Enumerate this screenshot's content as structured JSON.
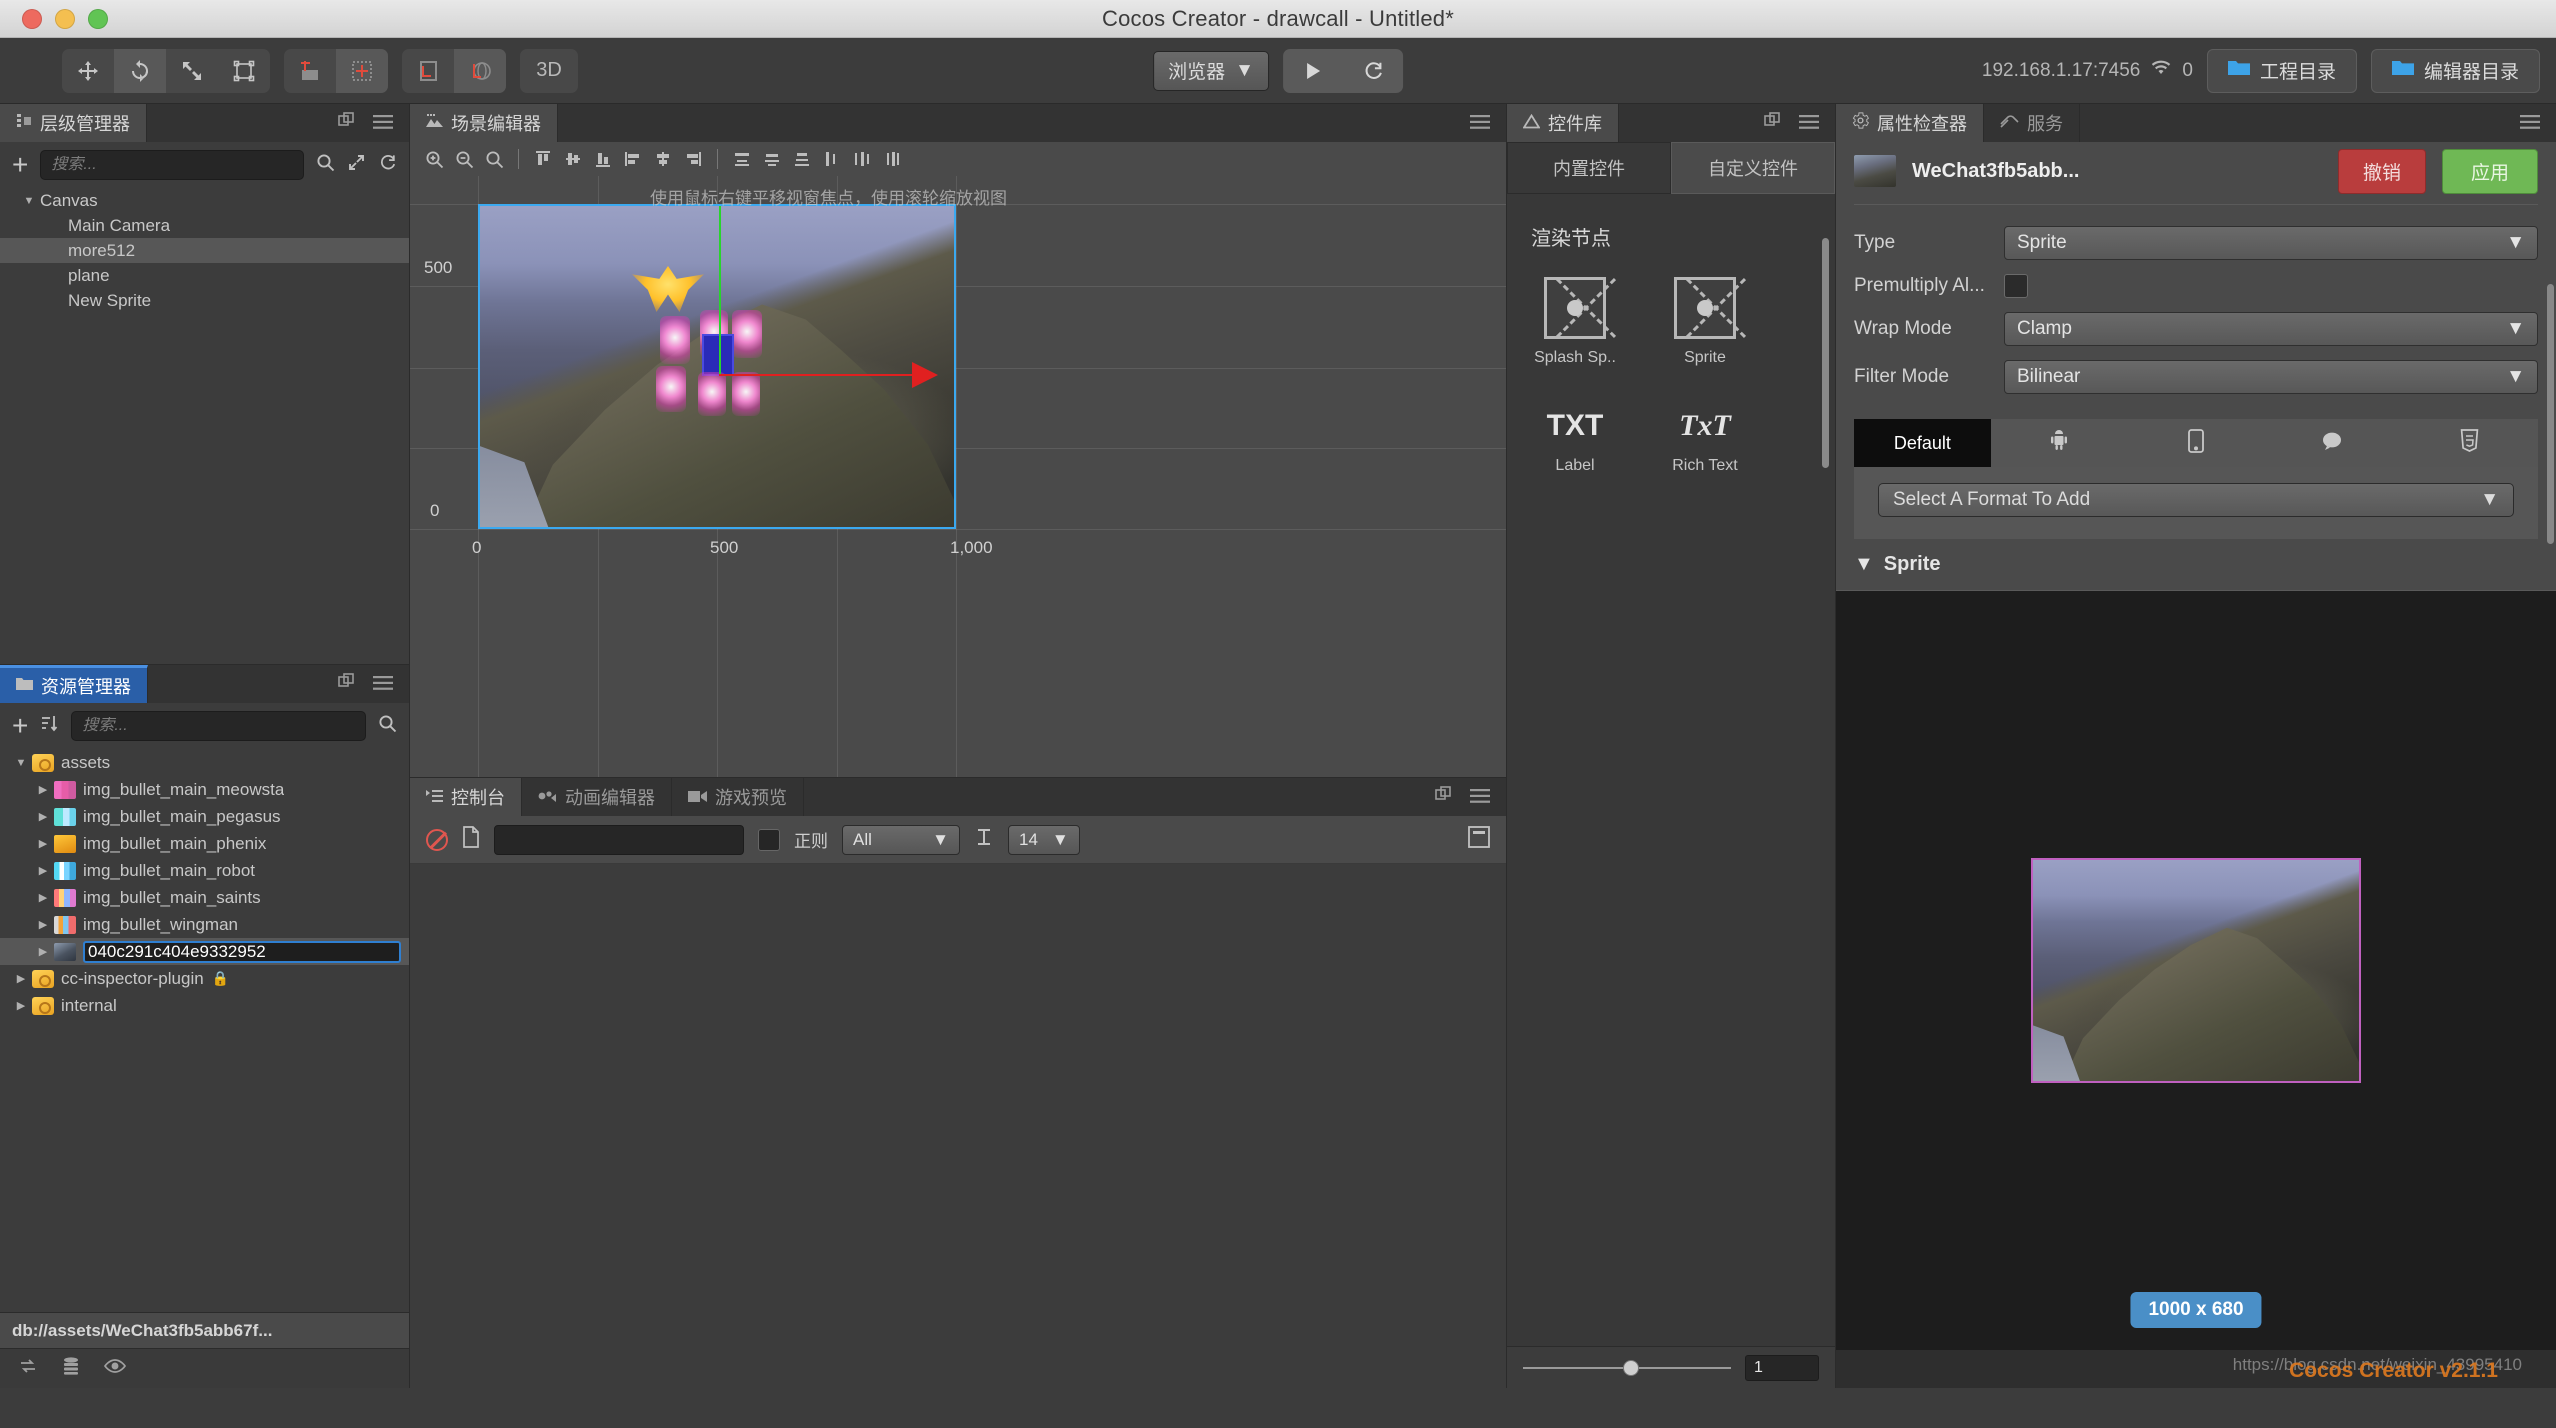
{
  "window": {
    "title": "Cocos Creator - drawcall - Untitled*",
    "traffic": {
      "close": "close-button",
      "minimize": "minimize-button",
      "maximize": "maximize-button"
    }
  },
  "toolbar": {
    "transform_tools": [
      {
        "name": "move-tool",
        "icon": "move-icon",
        "active": false
      },
      {
        "name": "rotate-tool",
        "icon": "rotate-icon",
        "active": true
      },
      {
        "name": "scale-tool",
        "icon": "scale-icon",
        "active": false
      },
      {
        "name": "rect-tool",
        "icon": "rect-transform-icon",
        "active": false
      }
    ],
    "pivot_tools": [
      {
        "name": "pivot-tool",
        "icon": "pivot-icon",
        "active": false
      },
      {
        "name": "center-tool",
        "icon": "center-icon",
        "active": true
      }
    ],
    "coord_tools": [
      {
        "name": "local-coord-tool",
        "icon": "local-axis-icon",
        "active": false
      },
      {
        "name": "global-coord-tool",
        "icon": "global-axis-icon",
        "active": true
      }
    ],
    "mode_3d_label": "3D",
    "preview_target": "浏览器",
    "play_label": "play-icon",
    "refresh_label": "refresh-icon",
    "ip_address": "192.168.1.17:7456",
    "wifi_icon": "wifi-icon",
    "device_count": "0",
    "project_dir_label": "工程目录",
    "editor_dir_label": "编辑器目录"
  },
  "hierarchy": {
    "tab_label": "层级管理器",
    "tab_icon": "hierarchy-icon",
    "search_placeholder": "搜索...",
    "add_label": "+",
    "tools": [
      "search-icon",
      "expand-icon",
      "refresh-icon"
    ],
    "panel_tools": [
      "popout-icon",
      "menu-icon"
    ],
    "nodes": [
      {
        "label": "Canvas",
        "depth": 0,
        "expanded": true,
        "selected": false
      },
      {
        "label": "Main Camera",
        "depth": 1,
        "expanded": false,
        "selected": false
      },
      {
        "label": "more512",
        "depth": 1,
        "expanded": false,
        "selected": true
      },
      {
        "label": "plane",
        "depth": 1,
        "expanded": false,
        "selected": false
      },
      {
        "label": "New Sprite",
        "depth": 1,
        "expanded": false,
        "selected": false
      }
    ]
  },
  "assets": {
    "tab_label": "资源管理器",
    "tab_icon": "folder-icon",
    "search_placeholder": "搜索...",
    "add_label": "+",
    "sort_icon": "sort-icon",
    "search_icon": "search-icon",
    "panel_tools": [
      "popout-icon",
      "menu-icon"
    ],
    "items": [
      {
        "label": "assets",
        "depth": 0,
        "expanded": true,
        "icon": "ico-folder",
        "selected": false,
        "locked": false,
        "editing": false
      },
      {
        "label": "img_bullet_main_meowsta",
        "depth": 1,
        "expanded": false,
        "icon": "ico-meow",
        "selected": false,
        "locked": false,
        "editing": false
      },
      {
        "label": "img_bullet_main_pegasus",
        "depth": 1,
        "expanded": false,
        "icon": "ico-peg",
        "selected": false,
        "locked": false,
        "editing": false
      },
      {
        "label": "img_bullet_main_phenix",
        "depth": 1,
        "expanded": false,
        "icon": "ico-phe",
        "selected": false,
        "locked": false,
        "editing": false
      },
      {
        "label": "img_bullet_main_robot",
        "depth": 1,
        "expanded": false,
        "icon": "ico-rob",
        "selected": false,
        "locked": false,
        "editing": false
      },
      {
        "label": "img_bullet_main_saints",
        "depth": 1,
        "expanded": false,
        "icon": "ico-sai",
        "selected": false,
        "locked": false,
        "editing": false
      },
      {
        "label": "img_bullet_wingman",
        "depth": 1,
        "expanded": false,
        "icon": "ico-wing",
        "selected": false,
        "locked": false,
        "editing": false
      },
      {
        "label": "040c291c404e9332952",
        "depth": 1,
        "expanded": false,
        "icon": "ico-img",
        "selected": true,
        "locked": false,
        "editing": true
      },
      {
        "label": "cc-inspector-plugin",
        "depth": 0,
        "expanded": false,
        "icon": "ico-folder",
        "selected": false,
        "locked": true,
        "editing": false
      },
      {
        "label": "internal",
        "depth": 0,
        "expanded": false,
        "icon": "ico-folder",
        "selected": false,
        "locked": false,
        "editing": false
      }
    ],
    "path_bar": "db://assets/WeChat3fb5abb67f...",
    "status_icons": [
      "sync-icon",
      "database-icon",
      "eye-icon"
    ]
  },
  "scene": {
    "tab_label": "场景编辑器",
    "tab_icon": "scene-icon",
    "panel_tools": [
      "menu-icon"
    ],
    "tools": [
      "zoom-in-icon",
      "zoom-out-icon",
      "zoom-reset-icon",
      "align-left-icon",
      "align-center-h-icon",
      "align-right-icon",
      "align-top-icon",
      "align-middle-icon",
      "align-bottom-icon",
      "distribute-h-start-icon",
      "distribute-h-center-icon",
      "distribute-h-end-icon",
      "distribute-v-start-icon",
      "distribute-v-center-icon",
      "distribute-v-end-icon"
    ],
    "hint": "使用鼠标右键平移视窗焦点，使用滚轮缩放视图",
    "ruler": {
      "y_500": "500",
      "y_0": "0",
      "x_0": "0",
      "x_500": "500",
      "x_1000": "1,000"
    }
  },
  "widget_library": {
    "tab_label": "控件库",
    "tab_icon": "widget-library-icon",
    "panel_tools": [
      "popout-icon",
      "menu-icon"
    ],
    "tabs": [
      {
        "label": "内置控件",
        "selected": false
      },
      {
        "label": "自定义控件",
        "selected": true
      }
    ],
    "section_title": "渲染节点",
    "items": [
      {
        "label": "Splash Sp..",
        "glyph": "node",
        "icon": "splash-sprite-icon"
      },
      {
        "label": "Sprite",
        "glyph": "node",
        "icon": "sprite-icon"
      },
      {
        "label": "Label",
        "glyph": "TXT",
        "icon": "label-icon"
      },
      {
        "label": "Rich Text",
        "glyph": "TxT",
        "icon": "rich-text-icon"
      }
    ],
    "zoom_value": "1"
  },
  "inspector": {
    "tabs": [
      {
        "label": "属性检查器",
        "icon": "gear-icon",
        "selected": true
      },
      {
        "label": "服务",
        "icon": "services-icon",
        "selected": false
      }
    ],
    "panel_tools": [
      "menu-icon"
    ],
    "asset_name": "WeChat3fb5abb...",
    "revert_label": "撤销",
    "apply_label": "应用",
    "properties": [
      {
        "label": "Type",
        "type": "select",
        "value": "Sprite"
      },
      {
        "label": "Premultiply Al...",
        "type": "checkbox",
        "value": false
      },
      {
        "label": "Wrap Mode",
        "type": "select",
        "value": "Clamp"
      },
      {
        "label": "Filter Mode",
        "type": "select",
        "value": "Bilinear"
      }
    ],
    "platform_tabs": [
      {
        "label": "Default",
        "icon": "default-icon",
        "selected": true
      },
      {
        "label": "",
        "icon": "android-icon",
        "selected": false
      },
      {
        "label": "",
        "icon": "ios-icon",
        "selected": false
      },
      {
        "label": "",
        "icon": "wechat-icon",
        "selected": false
      },
      {
        "label": "",
        "icon": "html5-icon",
        "selected": false
      }
    ],
    "format_placeholder": "Select A Format To Add",
    "sprite_section": "Sprite",
    "preview_size": "1000 x 680",
    "watermark_url": "https://blog.csdn.net/weixin_43995410",
    "watermark_version": "Cocos Creator v2.1.1"
  },
  "console": {
    "tabs": [
      {
        "label": "控制台",
        "icon": "console-icon",
        "selected": true
      },
      {
        "label": "动画编辑器",
        "icon": "animation-icon",
        "selected": false
      },
      {
        "label": "游戏预览",
        "icon": "game-preview-icon",
        "selected": false
      }
    ],
    "panel_tools": [
      "popout-icon",
      "menu-icon"
    ],
    "clear_icon": "clear-icon",
    "file_icon": "file-icon",
    "filter_value": "",
    "regex_checked": false,
    "regex_label": "正则",
    "level_filter": "All",
    "font_size_icon": "font-size-icon",
    "font_size": "14",
    "collapse_icon": "collapse-icon"
  }
}
